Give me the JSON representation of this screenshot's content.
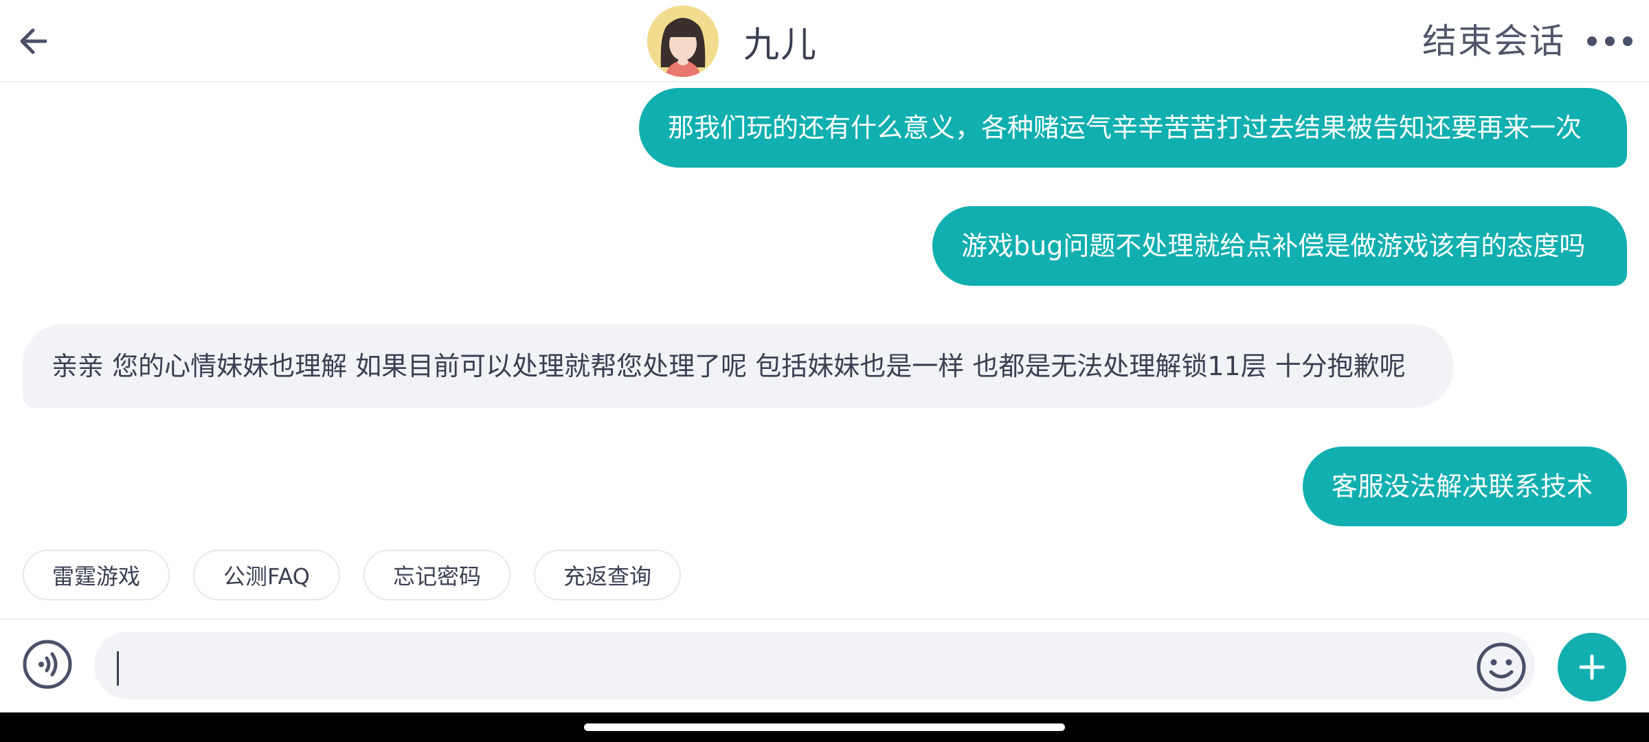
{
  "header": {
    "agent_name": "九儿",
    "end_session_label": "结束会话",
    "back_icon": "arrow-left-icon",
    "more_icon": "more-horizontal-icon",
    "avatar_icon": "girl-avatar"
  },
  "messages": [
    {
      "from": "user",
      "text": "那我们玩的还有什么意义，各种赌运气辛辛苦苦打过去结果被告知还要再来一次"
    },
    {
      "from": "user",
      "text": "游戏bug问题不处理就给点补偿是做游戏该有的态度吗"
    },
    {
      "from": "agent",
      "text": "亲亲 您的心情妹妹也理解 如果目前可以处理就帮您处理了呢 包括妹妹也是一样 也都是无法处理解锁11层 十分抱歉呢"
    },
    {
      "from": "user",
      "text": "客服没法解决联系技术"
    }
  ],
  "quick_replies": [
    {
      "label": "雷霆游戏"
    },
    {
      "label": "公测FAQ"
    },
    {
      "label": "忘记密码"
    },
    {
      "label": "充返查询"
    }
  ],
  "composer": {
    "value": "",
    "placeholder": "",
    "voice_icon": "voice-input-icon",
    "emoji_icon": "smiley-icon",
    "plus_icon": "plus-icon"
  },
  "colors": {
    "accent": "#11afb0",
    "incoming_bubble": "#f1f3f6",
    "text": "#3b3f52"
  }
}
